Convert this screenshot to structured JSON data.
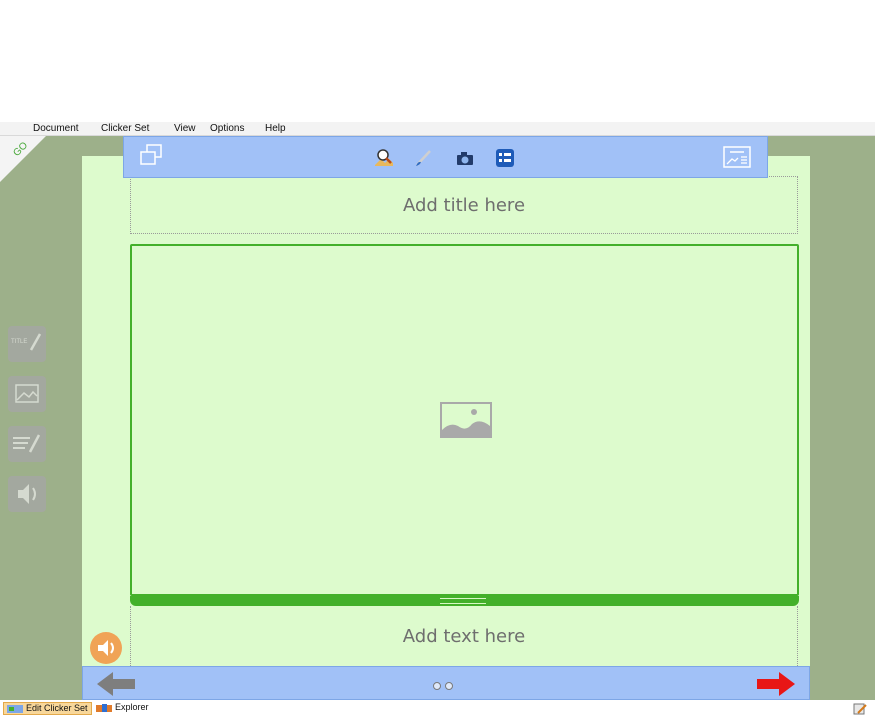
{
  "menu": [
    "Document",
    "Clicker Set",
    "View",
    "Options",
    "Help"
  ],
  "go_label": "GO",
  "toolbar": {
    "left_icon": "duplicate-windows-icon",
    "center_icons": [
      "search-picture-icon",
      "paint-brush-icon",
      "camera-icon",
      "list-layout-icon"
    ],
    "right_icon": "slide-layout-icon"
  },
  "side_tools": [
    "title-edit-icon",
    "picture-icon",
    "text-edit-icon",
    "speaker-icon"
  ],
  "side_title_text": "TITLE",
  "page": {
    "title_placeholder": "Add title here",
    "text_placeholder": "Add text here",
    "image_placeholder_icon": "image-placeholder-icon"
  },
  "navigation": {
    "back_icon": "grey-left-arrow-icon",
    "forward_icon": "red-right-arrow-icon",
    "page_dots": 2
  },
  "taskbar": {
    "items": [
      "Edit Clicker Set",
      "Explorer"
    ],
    "active": "Edit Clicker Set"
  },
  "colors": {
    "workspace": "#9db08a",
    "page": "#ddfbcd",
    "toolbar": "#a1c1f7",
    "accent_green": "#43b02a",
    "sound_button": "#f0a356",
    "forward_arrow": "#e81616"
  }
}
